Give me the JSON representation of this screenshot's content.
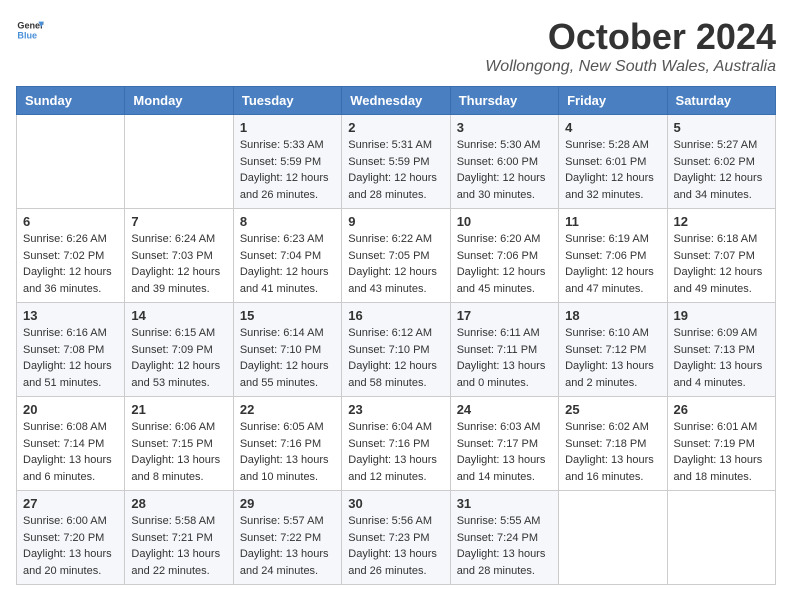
{
  "logo": {
    "text_general": "General",
    "text_blue": "Blue"
  },
  "title": "October 2024",
  "location": "Wollongong, New South Wales, Australia",
  "days_of_week": [
    "Sunday",
    "Monday",
    "Tuesday",
    "Wednesday",
    "Thursday",
    "Friday",
    "Saturday"
  ],
  "weeks": [
    [
      {
        "day": "",
        "sunrise": "",
        "sunset": "",
        "daylight": ""
      },
      {
        "day": "",
        "sunrise": "",
        "sunset": "",
        "daylight": ""
      },
      {
        "day": "1",
        "sunrise": "Sunrise: 5:33 AM",
        "sunset": "Sunset: 5:59 PM",
        "daylight": "Daylight: 12 hours and 26 minutes."
      },
      {
        "day": "2",
        "sunrise": "Sunrise: 5:31 AM",
        "sunset": "Sunset: 5:59 PM",
        "daylight": "Daylight: 12 hours and 28 minutes."
      },
      {
        "day": "3",
        "sunrise": "Sunrise: 5:30 AM",
        "sunset": "Sunset: 6:00 PM",
        "daylight": "Daylight: 12 hours and 30 minutes."
      },
      {
        "day": "4",
        "sunrise": "Sunrise: 5:28 AM",
        "sunset": "Sunset: 6:01 PM",
        "daylight": "Daylight: 12 hours and 32 minutes."
      },
      {
        "day": "5",
        "sunrise": "Sunrise: 5:27 AM",
        "sunset": "Sunset: 6:02 PM",
        "daylight": "Daylight: 12 hours and 34 minutes."
      }
    ],
    [
      {
        "day": "6",
        "sunrise": "Sunrise: 6:26 AM",
        "sunset": "Sunset: 7:02 PM",
        "daylight": "Daylight: 12 hours and 36 minutes."
      },
      {
        "day": "7",
        "sunrise": "Sunrise: 6:24 AM",
        "sunset": "Sunset: 7:03 PM",
        "daylight": "Daylight: 12 hours and 39 minutes."
      },
      {
        "day": "8",
        "sunrise": "Sunrise: 6:23 AM",
        "sunset": "Sunset: 7:04 PM",
        "daylight": "Daylight: 12 hours and 41 minutes."
      },
      {
        "day": "9",
        "sunrise": "Sunrise: 6:22 AM",
        "sunset": "Sunset: 7:05 PM",
        "daylight": "Daylight: 12 hours and 43 minutes."
      },
      {
        "day": "10",
        "sunrise": "Sunrise: 6:20 AM",
        "sunset": "Sunset: 7:06 PM",
        "daylight": "Daylight: 12 hours and 45 minutes."
      },
      {
        "day": "11",
        "sunrise": "Sunrise: 6:19 AM",
        "sunset": "Sunset: 7:06 PM",
        "daylight": "Daylight: 12 hours and 47 minutes."
      },
      {
        "day": "12",
        "sunrise": "Sunrise: 6:18 AM",
        "sunset": "Sunset: 7:07 PM",
        "daylight": "Daylight: 12 hours and 49 minutes."
      }
    ],
    [
      {
        "day": "13",
        "sunrise": "Sunrise: 6:16 AM",
        "sunset": "Sunset: 7:08 PM",
        "daylight": "Daylight: 12 hours and 51 minutes."
      },
      {
        "day": "14",
        "sunrise": "Sunrise: 6:15 AM",
        "sunset": "Sunset: 7:09 PM",
        "daylight": "Daylight: 12 hours and 53 minutes."
      },
      {
        "day": "15",
        "sunrise": "Sunrise: 6:14 AM",
        "sunset": "Sunset: 7:10 PM",
        "daylight": "Daylight: 12 hours and 55 minutes."
      },
      {
        "day": "16",
        "sunrise": "Sunrise: 6:12 AM",
        "sunset": "Sunset: 7:10 PM",
        "daylight": "Daylight: 12 hours and 58 minutes."
      },
      {
        "day": "17",
        "sunrise": "Sunrise: 6:11 AM",
        "sunset": "Sunset: 7:11 PM",
        "daylight": "Daylight: 13 hours and 0 minutes."
      },
      {
        "day": "18",
        "sunrise": "Sunrise: 6:10 AM",
        "sunset": "Sunset: 7:12 PM",
        "daylight": "Daylight: 13 hours and 2 minutes."
      },
      {
        "day": "19",
        "sunrise": "Sunrise: 6:09 AM",
        "sunset": "Sunset: 7:13 PM",
        "daylight": "Daylight: 13 hours and 4 minutes."
      }
    ],
    [
      {
        "day": "20",
        "sunrise": "Sunrise: 6:08 AM",
        "sunset": "Sunset: 7:14 PM",
        "daylight": "Daylight: 13 hours and 6 minutes."
      },
      {
        "day": "21",
        "sunrise": "Sunrise: 6:06 AM",
        "sunset": "Sunset: 7:15 PM",
        "daylight": "Daylight: 13 hours and 8 minutes."
      },
      {
        "day": "22",
        "sunrise": "Sunrise: 6:05 AM",
        "sunset": "Sunset: 7:16 PM",
        "daylight": "Daylight: 13 hours and 10 minutes."
      },
      {
        "day": "23",
        "sunrise": "Sunrise: 6:04 AM",
        "sunset": "Sunset: 7:16 PM",
        "daylight": "Daylight: 13 hours and 12 minutes."
      },
      {
        "day": "24",
        "sunrise": "Sunrise: 6:03 AM",
        "sunset": "Sunset: 7:17 PM",
        "daylight": "Daylight: 13 hours and 14 minutes."
      },
      {
        "day": "25",
        "sunrise": "Sunrise: 6:02 AM",
        "sunset": "Sunset: 7:18 PM",
        "daylight": "Daylight: 13 hours and 16 minutes."
      },
      {
        "day": "26",
        "sunrise": "Sunrise: 6:01 AM",
        "sunset": "Sunset: 7:19 PM",
        "daylight": "Daylight: 13 hours and 18 minutes."
      }
    ],
    [
      {
        "day": "27",
        "sunrise": "Sunrise: 6:00 AM",
        "sunset": "Sunset: 7:20 PM",
        "daylight": "Daylight: 13 hours and 20 minutes."
      },
      {
        "day": "28",
        "sunrise": "Sunrise: 5:58 AM",
        "sunset": "Sunset: 7:21 PM",
        "daylight": "Daylight: 13 hours and 22 minutes."
      },
      {
        "day": "29",
        "sunrise": "Sunrise: 5:57 AM",
        "sunset": "Sunset: 7:22 PM",
        "daylight": "Daylight: 13 hours and 24 minutes."
      },
      {
        "day": "30",
        "sunrise": "Sunrise: 5:56 AM",
        "sunset": "Sunset: 7:23 PM",
        "daylight": "Daylight: 13 hours and 26 minutes."
      },
      {
        "day": "31",
        "sunrise": "Sunrise: 5:55 AM",
        "sunset": "Sunset: 7:24 PM",
        "daylight": "Daylight: 13 hours and 28 minutes."
      },
      {
        "day": "",
        "sunrise": "",
        "sunset": "",
        "daylight": ""
      },
      {
        "day": "",
        "sunrise": "",
        "sunset": "",
        "daylight": ""
      }
    ]
  ]
}
